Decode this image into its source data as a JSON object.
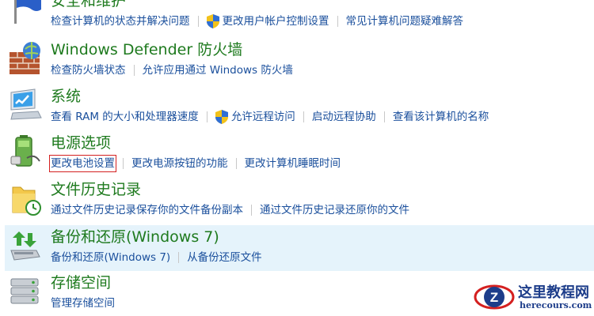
{
  "categories": [
    {
      "title": "安全和维护",
      "icon": "flag-icon",
      "links": [
        {
          "label": "检查计算机的状态并解决问题",
          "shield": false
        },
        {
          "label": "更改用户帐户控制设置",
          "shield": true
        },
        {
          "label": "常见计算机问题疑难解答",
          "shield": false
        }
      ]
    },
    {
      "title": "Windows Defender 防火墙",
      "icon": "firewall-icon",
      "links": [
        {
          "label": "检查防火墙状态",
          "shield": false
        },
        {
          "label": "允许应用通过 Windows 防火墙",
          "shield": false
        }
      ]
    },
    {
      "title": "系统",
      "icon": "computer-icon",
      "links": [
        {
          "label": "查看 RAM 的大小和处理器速度",
          "shield": false
        },
        {
          "label": "允许远程访问",
          "shield": true
        },
        {
          "label": "启动远程协助",
          "shield": false
        },
        {
          "label": "查看该计算机的名称",
          "shield": false
        }
      ]
    },
    {
      "title": "电源选项",
      "icon": "battery-icon",
      "links": [
        {
          "label": "更改电池设置",
          "shield": false,
          "boxed": true
        },
        {
          "label": "更改电源按钮的功能",
          "shield": false
        },
        {
          "label": "更改计算机睡眠时间",
          "shield": false
        }
      ]
    },
    {
      "title": "文件历史记录",
      "icon": "folder-clock-icon",
      "links": [
        {
          "label": "通过文件历史记录保存你的文件备份副本",
          "shield": false
        },
        {
          "label": "通过文件历史记录还原你的文件",
          "shield": false
        }
      ]
    },
    {
      "title": "备份和还原(Windows 7)",
      "icon": "backup-icon",
      "highlight": true,
      "links": [
        {
          "label": "备份和还原(Windows 7)",
          "shield": false
        },
        {
          "label": "从备份还原文件",
          "shield": false
        }
      ]
    },
    {
      "title": "存储空间",
      "icon": "storage-icon",
      "links": [
        {
          "label": "管理存储空间",
          "shield": false
        }
      ]
    }
  ],
  "watermark": {
    "title": "这里教程网",
    "url": "herecours.com"
  },
  "colors": {
    "title": "#1e7a1e",
    "link": "#1a4f9c",
    "highlight": "#e5f3fb",
    "selection_box": "#d42020"
  }
}
